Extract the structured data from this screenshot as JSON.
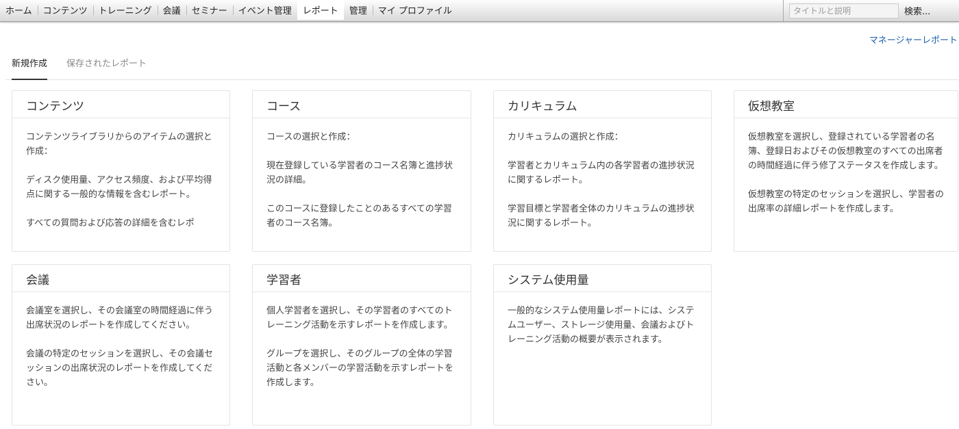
{
  "nav": {
    "items": [
      {
        "label": "ホーム",
        "active": false
      },
      {
        "label": "コンテンツ",
        "active": false
      },
      {
        "label": "トレーニング",
        "active": false
      },
      {
        "label": "会議",
        "active": false
      },
      {
        "label": "セミナー",
        "active": false
      },
      {
        "label": "イベント管理",
        "active": false
      },
      {
        "label": "レポート",
        "active": true
      },
      {
        "label": "管理",
        "active": false
      },
      {
        "label": "マイ プロファイル",
        "active": false
      }
    ],
    "search_placeholder": "タイトルと説明",
    "search_button": "検索..."
  },
  "manager_report_link": "マネージャーレポート",
  "tabs": [
    {
      "label": "新規作成",
      "selected": true
    },
    {
      "label": "保存されたレポート",
      "selected": false
    }
  ],
  "cards": [
    {
      "title": "コンテンツ",
      "paragraphs": [
        "コンテンツライブラリからのアイテムの選択と作成：",
        "ディスク使用量、アクセス頻度、および平均得点に関する一般的な情報を含むレポート。",
        "すべての質問および応答の詳細を含むレポ"
      ]
    },
    {
      "title": "コース",
      "paragraphs": [
        "コースの選択と作成：",
        "現在登録している学習者のコース名簿と進捗状況の詳細。",
        "このコースに登録したことのあるすべての学習者のコース名簿。"
      ]
    },
    {
      "title": "カリキュラム",
      "paragraphs": [
        "カリキュラムの選択と作成：",
        "学習者とカリキュラム内の各学習者の進捗状況に関するレポート。",
        "学習目標と学習者全体のカリキュラムの進捗状況に関するレポート。"
      ]
    },
    {
      "title": "仮想教室",
      "paragraphs": [
        "仮想教室を選択し、登録されている学習者の名簿、登録日およびその仮想教室のすべての出席者の時間経過に伴う修了ステータスを作成します。",
        "仮想教室の特定のセッションを選択し、学習者の出席率の詳細レポートを作成します。"
      ]
    },
    {
      "title": "会議",
      "paragraphs": [
        "会議室を選択し、その会議室の時間経過に伴う出席状況のレポートを作成してください。",
        "会議の特定のセッションを選択し、その会議セッションの出席状況のレポートを作成してください。"
      ]
    },
    {
      "title": "学習者",
      "paragraphs": [
        "個人学習者を選択し、その学習者のすべてのトレーニング活動を示すレポートを作成します。",
        "グループを選択し、そのグループの全体の学習活動と各メンバーの学習活動を示すレポートを作成します。"
      ]
    },
    {
      "title": "システム使用量",
      "paragraphs": [
        "一般的なシステム使用量レポートには、システムユーザー、ストレージ使用量、会議およびトレーニング活動の概要が表示されます。"
      ]
    }
  ],
  "colors": {
    "link": "#1a5fa8",
    "active_tab_underline": "#333333"
  }
}
